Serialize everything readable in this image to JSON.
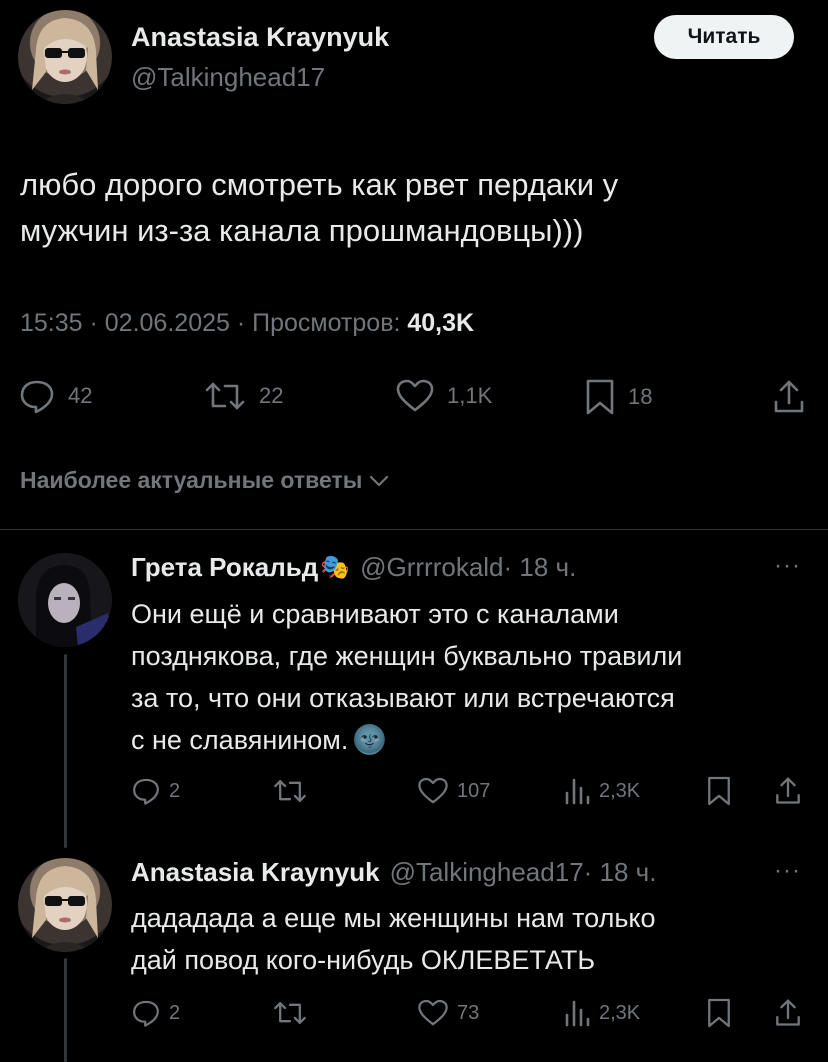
{
  "main_post": {
    "author_name": "Anastasia Kraynyuk",
    "author_handle": "@Talkinghead17",
    "follow_label": "Читать",
    "text_line1": "любо дорого смотреть как рвет пердаки у",
    "text_line2": "мужчин из-за канала прошмандовцы)))",
    "meta_time": "15:35 · 02.06.2025 · Просмотров: ",
    "meta_views": "40,3K",
    "replies": "42",
    "reposts": "22",
    "likes": "1,1K",
    "bookmarks": "18",
    "icons": [
      "reply-icon",
      "repost-icon",
      "like-icon",
      "bookmark-icon",
      "share-icon"
    ]
  },
  "sort_label": "Наиболее актуальные ответы",
  "replies": [
    {
      "author_name": "Грета Рокальд",
      "emoji": "🎭",
      "author_handle": "@Grrrrokald",
      "time": " · 18 ч.",
      "more": "···",
      "lines": [
        "Они ещё и сравнивают это с каналами",
        "позднякова, где женщин буквально травили",
        "за то, что они отказывают или встречаются",
        "с не славянином."
      ],
      "trail_emoji": "🌚",
      "replies": "2",
      "reposts": "",
      "likes": "107",
      "views": "2,3K"
    },
    {
      "author_name": "Anastasia Kraynyuk",
      "author_handle": "@Talkinghead17",
      "time": " · 18 ч.",
      "more": "···",
      "lines": [
        "дададада а еще мы женщины нам только",
        "дай повод кого-нибудь ОКЛЕВЕТАТЬ"
      ],
      "replies": "2",
      "reposts": "",
      "likes": "73",
      "views": "2,3K"
    }
  ],
  "colors": {
    "background": "#000000",
    "text": "#e7e9ea",
    "muted": "#71767b",
    "divider": "#2f3336"
  }
}
